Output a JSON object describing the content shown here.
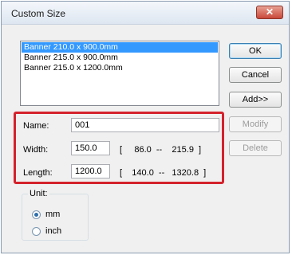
{
  "window": {
    "title": "Custom Size",
    "close_glyph": "✕"
  },
  "list": {
    "items": [
      {
        "label": "Banner 210.0 x 900.0mm",
        "selected": true
      },
      {
        "label": "Banner 215.0 x 900.0mm",
        "selected": false
      },
      {
        "label": "Banner 215.0 x 1200.0mm",
        "selected": false
      }
    ]
  },
  "buttons": {
    "ok": "OK",
    "cancel": "Cancel",
    "add": "Add>>",
    "modify": "Modify",
    "delete": "Delete"
  },
  "form": {
    "name_label": "Name:",
    "name_value": "001",
    "width_label": "Width:",
    "width_value": "150.0",
    "width_range": "[     86.0  --    215.9  ]",
    "length_label": "Length:",
    "length_value": "1200.0",
    "length_range": "[    140.0  --   1320.8  ]"
  },
  "unit": {
    "title": "Unit:",
    "options": [
      {
        "label": "mm",
        "selected": true
      },
      {
        "label": "inch",
        "selected": false
      }
    ]
  },
  "colors": {
    "highlight": "#d4222c",
    "selection": "#3399ff"
  }
}
